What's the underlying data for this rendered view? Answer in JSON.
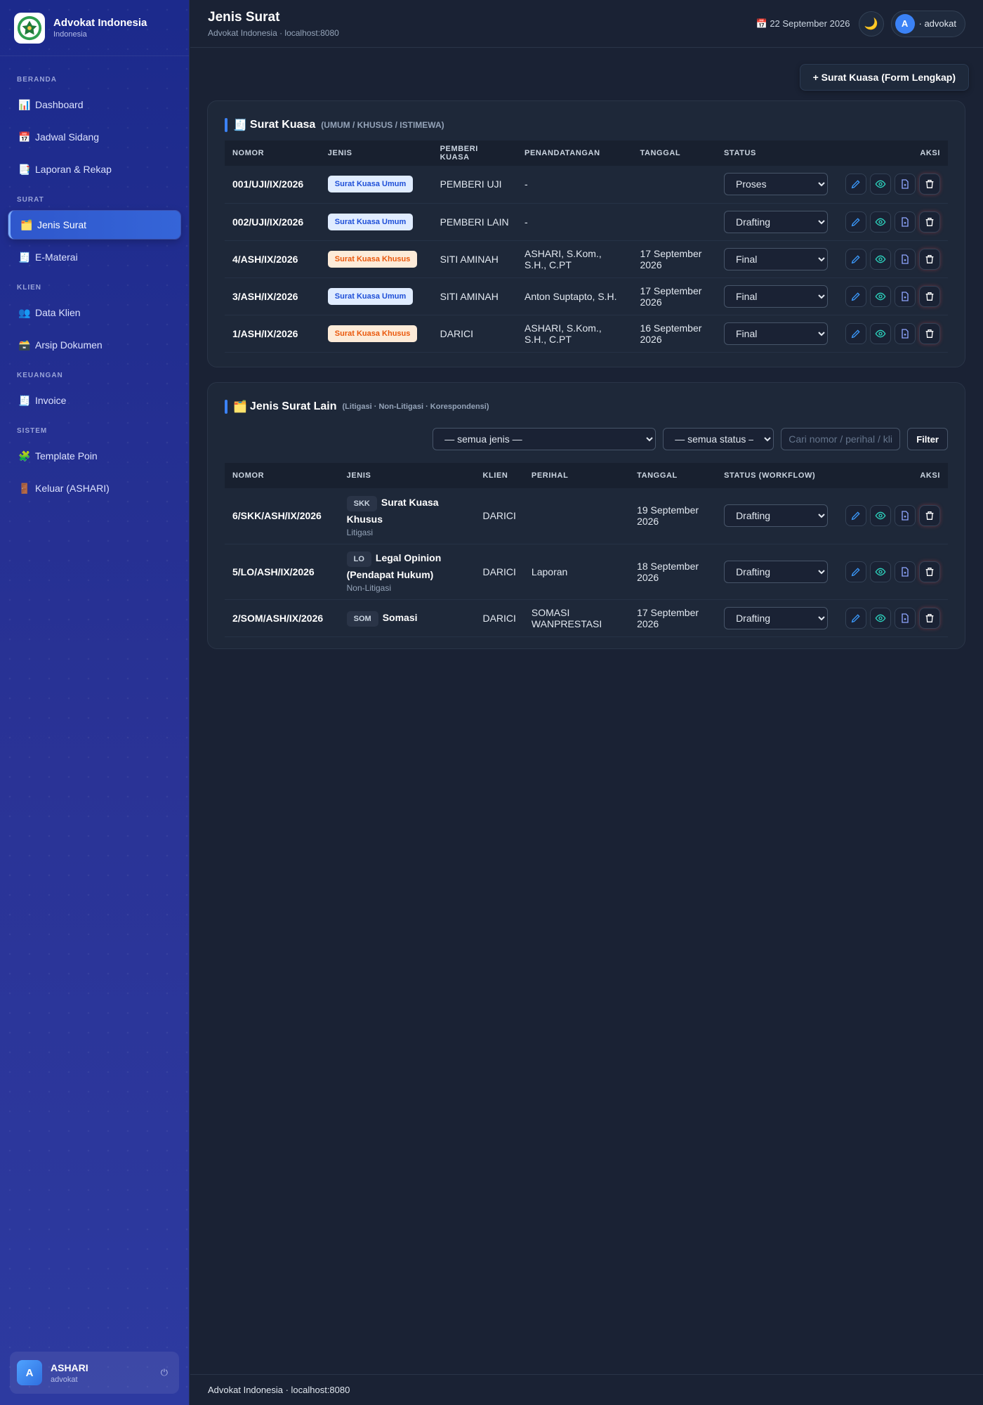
{
  "app": {
    "name": "Advokat Indonesia",
    "sub": "Indonesia"
  },
  "sidebar": {
    "sections": [
      {
        "title": "BERANDA",
        "items": [
          {
            "icon": "📊",
            "label": "Dashboard"
          },
          {
            "icon": "📅",
            "label": "Jadwal Sidang"
          },
          {
            "icon": "📑",
            "label": "Laporan & Rekap"
          }
        ]
      },
      {
        "title": "SURAT",
        "items": [
          {
            "icon": "🗂️",
            "label": "Jenis Surat",
            "active": true
          },
          {
            "icon": "🧾",
            "label": "E-Materai"
          }
        ]
      },
      {
        "title": "KLIEN",
        "items": [
          {
            "icon": "👥",
            "label": "Data Klien"
          },
          {
            "icon": "🗃️",
            "label": "Arsip Dokumen"
          }
        ]
      },
      {
        "title": "KEUANGAN",
        "items": [
          {
            "icon": "🧾",
            "label": "Invoice"
          }
        ]
      },
      {
        "title": "SISTEM",
        "items": [
          {
            "icon": "🧩",
            "label": "Template Poin"
          },
          {
            "icon": "🚪",
            "label": "Keluar (ASHARI)"
          }
        ]
      }
    ],
    "user": {
      "avatar": "A",
      "name": "ASHARI",
      "role": "advokat"
    }
  },
  "header": {
    "title": "Jenis Surat",
    "subtitle": "Advokat Indonesia · localhost:8080",
    "date": "📅 22 September 2026",
    "theme_icon": "🌙",
    "user_avatar": "A",
    "user_label": "· advokat"
  },
  "add_button": "+ Surat Kuasa (Form Lengkap)",
  "surat_kuasa": {
    "icon": "🧾",
    "title": "Surat Kuasa",
    "subtitle": "(UMUM / KHUSUS / ISTIMEWA)",
    "columns": [
      "NOMOR",
      "JENIS",
      "PEMBERI KUASA",
      "PENANDATANGAN",
      "TANGGAL",
      "STATUS",
      "AKSI"
    ],
    "rows": [
      {
        "nomor": "001/UJI/IX/2026",
        "jenis": "Surat Kuasa Umum",
        "kind": "umum",
        "pemberi": "PEMBERI UJI",
        "penandatangan": "-",
        "tanggal": "",
        "status": "Proses"
      },
      {
        "nomor": "002/UJI/IX/2026",
        "jenis": "Surat Kuasa Umum",
        "kind": "umum",
        "pemberi": "PEMBERI LAIN",
        "penandatangan": "-",
        "tanggal": "",
        "status": "Drafting"
      },
      {
        "nomor": "4/ASH/IX/2026",
        "jenis": "Surat Kuasa Khusus",
        "kind": "khusus",
        "pemberi": "SITI AMINAH",
        "penandatangan": "ASHARI, S.Kom., S.H., C.PT",
        "tanggal": "17 September 2026",
        "status": "Final"
      },
      {
        "nomor": "3/ASH/IX/2026",
        "jenis": "Surat Kuasa Umum",
        "kind": "umum",
        "pemberi": "SITI AMINAH",
        "penandatangan": "Anton Suptapto, S.H.",
        "tanggal": "17 September 2026",
        "status": "Final"
      },
      {
        "nomor": "1/ASH/IX/2026",
        "jenis": "Surat Kuasa Khusus",
        "kind": "khusus",
        "pemberi": "DARICI",
        "penandatangan": "ASHARI, S.Kom., S.H., C.PT",
        "tanggal": "16 September 2026",
        "status": "Final"
      }
    ],
    "status_options": [
      "Drafting",
      "Proses",
      "Final"
    ]
  },
  "surat_lain": {
    "icon": "🗂️",
    "title": "Jenis Surat Lain",
    "subtitle": "(Litigasi · Non-Litigasi · Korespondensi)",
    "filter": {
      "jenis_selected": "— semua jenis —",
      "status_selected": "— semua status —",
      "search_placeholder": "Cari nomor / perihal / klien",
      "button": "Filter"
    },
    "columns": [
      "NOMOR",
      "JENIS",
      "KLIEN",
      "PERIHAL",
      "TANGGAL",
      "STATUS (WORKFLOW)",
      "AKSI"
    ],
    "rows": [
      {
        "nomor": "6/SKK/ASH/IX/2026",
        "code": "SKK",
        "jenis": "Surat Kuasa Khusus",
        "kategori": "Litigasi",
        "klien": "DARICI",
        "perihal": "",
        "tanggal": "19 September 2026",
        "status": "Drafting"
      },
      {
        "nomor": "5/LO/ASH/IX/2026",
        "code": "LO",
        "jenis": "Legal Opinion (Pendapat Hukum)",
        "kategori": "Non-Litigasi",
        "klien": "DARICI",
        "perihal": "Laporan",
        "tanggal": "18 September 2026",
        "status": "Drafting"
      },
      {
        "nomor": "2/SOM/ASH/IX/2026",
        "code": "SOM",
        "jenis": "Somasi",
        "kategori": "",
        "klien": "DARICI",
        "perihal": "SOMASI WANPRESTASI",
        "tanggal": "17 September 2026",
        "status": "Drafting"
      }
    ]
  },
  "footer": "Advokat Indonesia · localhost:8080",
  "colors": {
    "accent": "#3b82f6",
    "sidebar": "#2a3396",
    "bg": "#1a2234"
  }
}
